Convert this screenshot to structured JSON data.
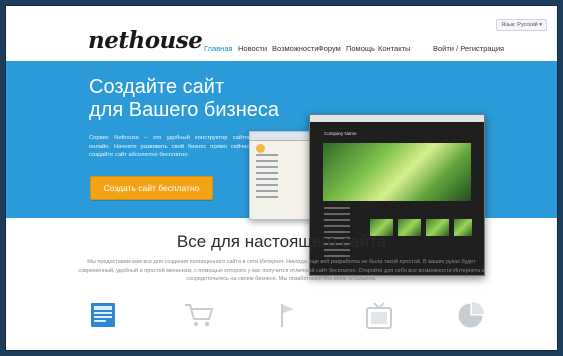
{
  "header": {
    "logo": "nethouse",
    "nav": [
      {
        "label": "Главная"
      },
      {
        "label": "Новости"
      },
      {
        "label": "Возможности"
      },
      {
        "label": "Форум"
      },
      {
        "label": "Помощь"
      },
      {
        "label": "Контакты"
      }
    ],
    "login": "Войти / Регистрация",
    "language": "Язык: Русский ▾"
  },
  "hero": {
    "title_line1": "Создайте сайт",
    "title_line2": "для Вашего бизнеса",
    "description": "Сервис Nethouse – это удобный конструктор сайтов онлайн. Начните развивать свой бизнес прямо сейчас: создайте сайт абсолютно бесплатно.",
    "cta": "Создать сайт бесплатно",
    "screenshot_brand": "Company Name"
  },
  "features": {
    "title": "Все для настоящего сайта",
    "text": "Мы предоставим вам все для создания полноценного сайта в сети Интернет. Никогда еще веб разработка не была такой простой. В ваших руках будет современный, удобный и простой механизм, с помощью которого у вас получится отличный сайт бесплатно. Откройте для себя все возможности Интернета и сосредоточьтесь на своем бизнесе. Мы позаботимся обо всем остальном.",
    "icons": [
      "layout-icon",
      "cart-icon",
      "flag-icon",
      "tv-icon",
      "pie-chart-icon"
    ]
  },
  "colors": {
    "hero_bg": "#2b9ad8",
    "accent": "#f2a416",
    "nav_active": "#1a8ad4"
  }
}
